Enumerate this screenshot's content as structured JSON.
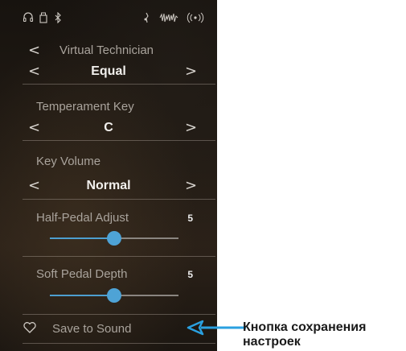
{
  "status_icons": [
    "headphones-icon",
    "usb-icon",
    "bluetooth-icon",
    "microphone-icon",
    "waveform-icon",
    "wireless-icon"
  ],
  "nav": {
    "title": "Virtual Technician"
  },
  "temperament": {
    "value": "Equal"
  },
  "temperament_key": {
    "label": "Temperament Key",
    "value": "C"
  },
  "key_volume": {
    "label": "Key Volume",
    "value": "Normal"
  },
  "half_pedal": {
    "label": "Half-Pedal Adjust",
    "value": "5",
    "level_fraction": 0.5
  },
  "soft_pedal": {
    "label": "Soft Pedal Depth",
    "value": "5",
    "level_fraction": 0.5
  },
  "save": {
    "label": "Save to Sound"
  },
  "callout": {
    "text": "Кнопка сохранения настроек",
    "color": "#2aa0e0"
  },
  "colors": {
    "accent": "#4ea3d6"
  }
}
